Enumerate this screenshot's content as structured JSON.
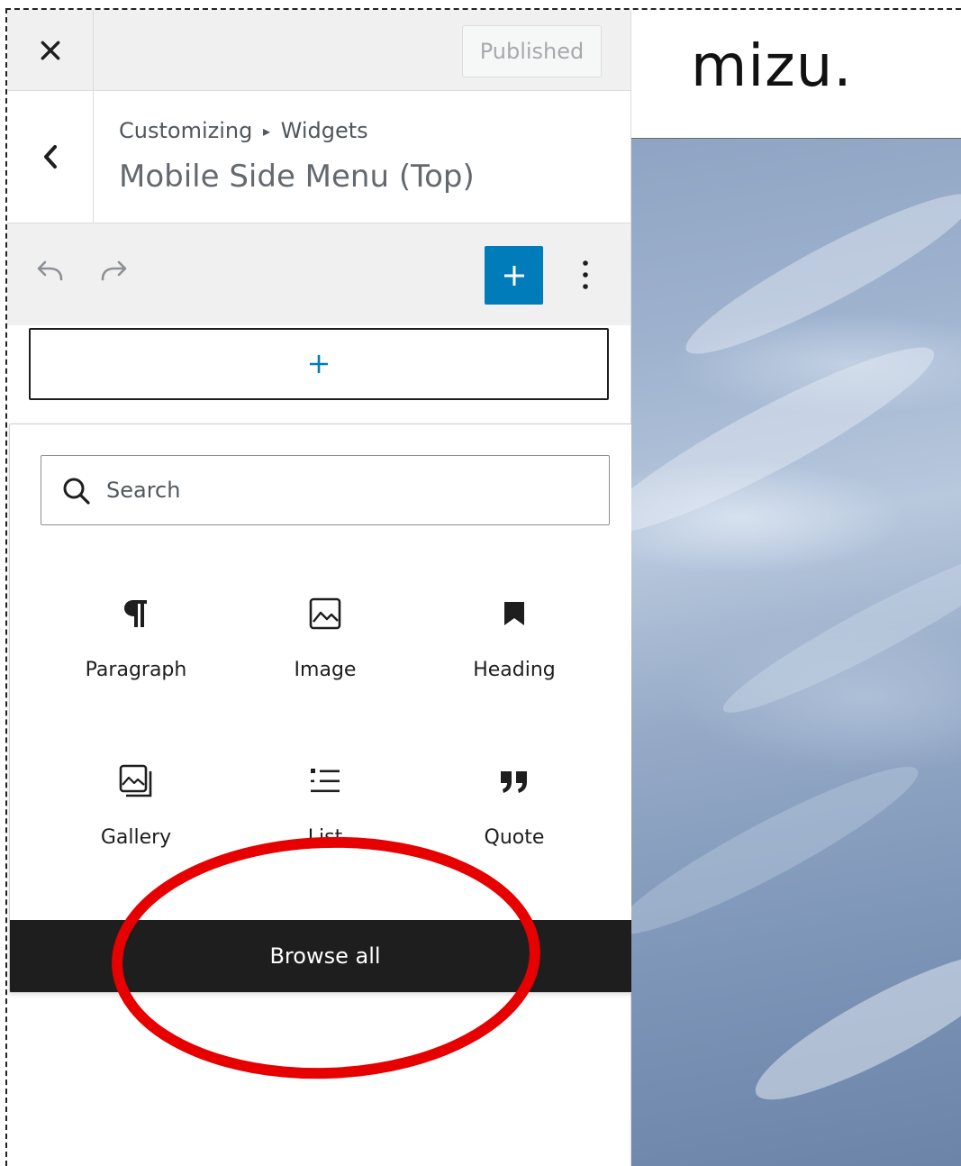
{
  "topbar": {
    "close_label": "Close",
    "published_label": "Published"
  },
  "section": {
    "breadcrumb_root": "Customizing",
    "breadcrumb_separator": "▸",
    "breadcrumb_child": "Widgets",
    "title": "Mobile Side Menu (Top)"
  },
  "toolbar": {
    "undo_icon": "undo-icon",
    "redo_icon": "redo-icon",
    "add_block_icon": "plus-icon",
    "options_icon": "more-vertical-icon"
  },
  "inserter": {
    "search_placeholder": "Search",
    "blocks": [
      {
        "label": "Paragraph",
        "icon": "paragraph-icon"
      },
      {
        "label": "Image",
        "icon": "image-icon"
      },
      {
        "label": "Heading",
        "icon": "heading-bookmark-icon"
      },
      {
        "label": "Gallery",
        "icon": "gallery-icon"
      },
      {
        "label": "List",
        "icon": "list-icon"
      },
      {
        "label": "Quote",
        "icon": "quote-icon"
      }
    ],
    "browse_all_label": "Browse all"
  },
  "preview": {
    "site_logo": "mizu."
  },
  "colors": {
    "accent": "#007cba",
    "dark": "#1e1e1e",
    "annotation": "#e60000"
  }
}
